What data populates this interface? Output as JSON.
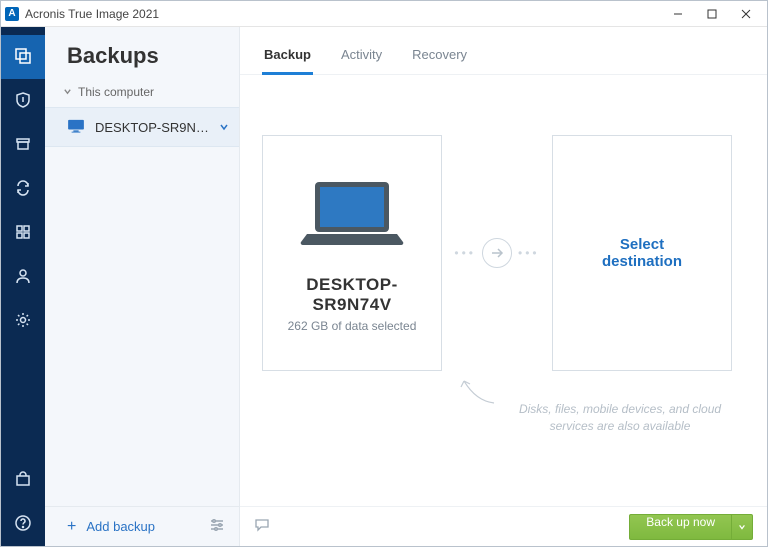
{
  "titlebar": {
    "title": "Acronis True Image 2021",
    "logo_letter": "A"
  },
  "sidebar": {
    "heading": "Backups",
    "group_label": "This computer",
    "items": [
      {
        "name": "DESKTOP-SR9N74V"
      }
    ],
    "add_label": "Add backup"
  },
  "tabs": [
    {
      "label": "Backup",
      "active": true
    },
    {
      "label": "Activity",
      "active": false
    },
    {
      "label": "Recovery",
      "active": false
    }
  ],
  "source_card": {
    "name": "DESKTOP-SR9N74V",
    "subtitle": "262 GB of data selected"
  },
  "dest_card": {
    "line1": "Select",
    "line2": "destination"
  },
  "hint": "Disks, files, mobile devices, and cloud services are also available",
  "footer": {
    "backup_button": "Back up now"
  },
  "colors": {
    "rail": "#0b2a52",
    "accent": "#1e7fd6",
    "green": "#86c04a"
  }
}
